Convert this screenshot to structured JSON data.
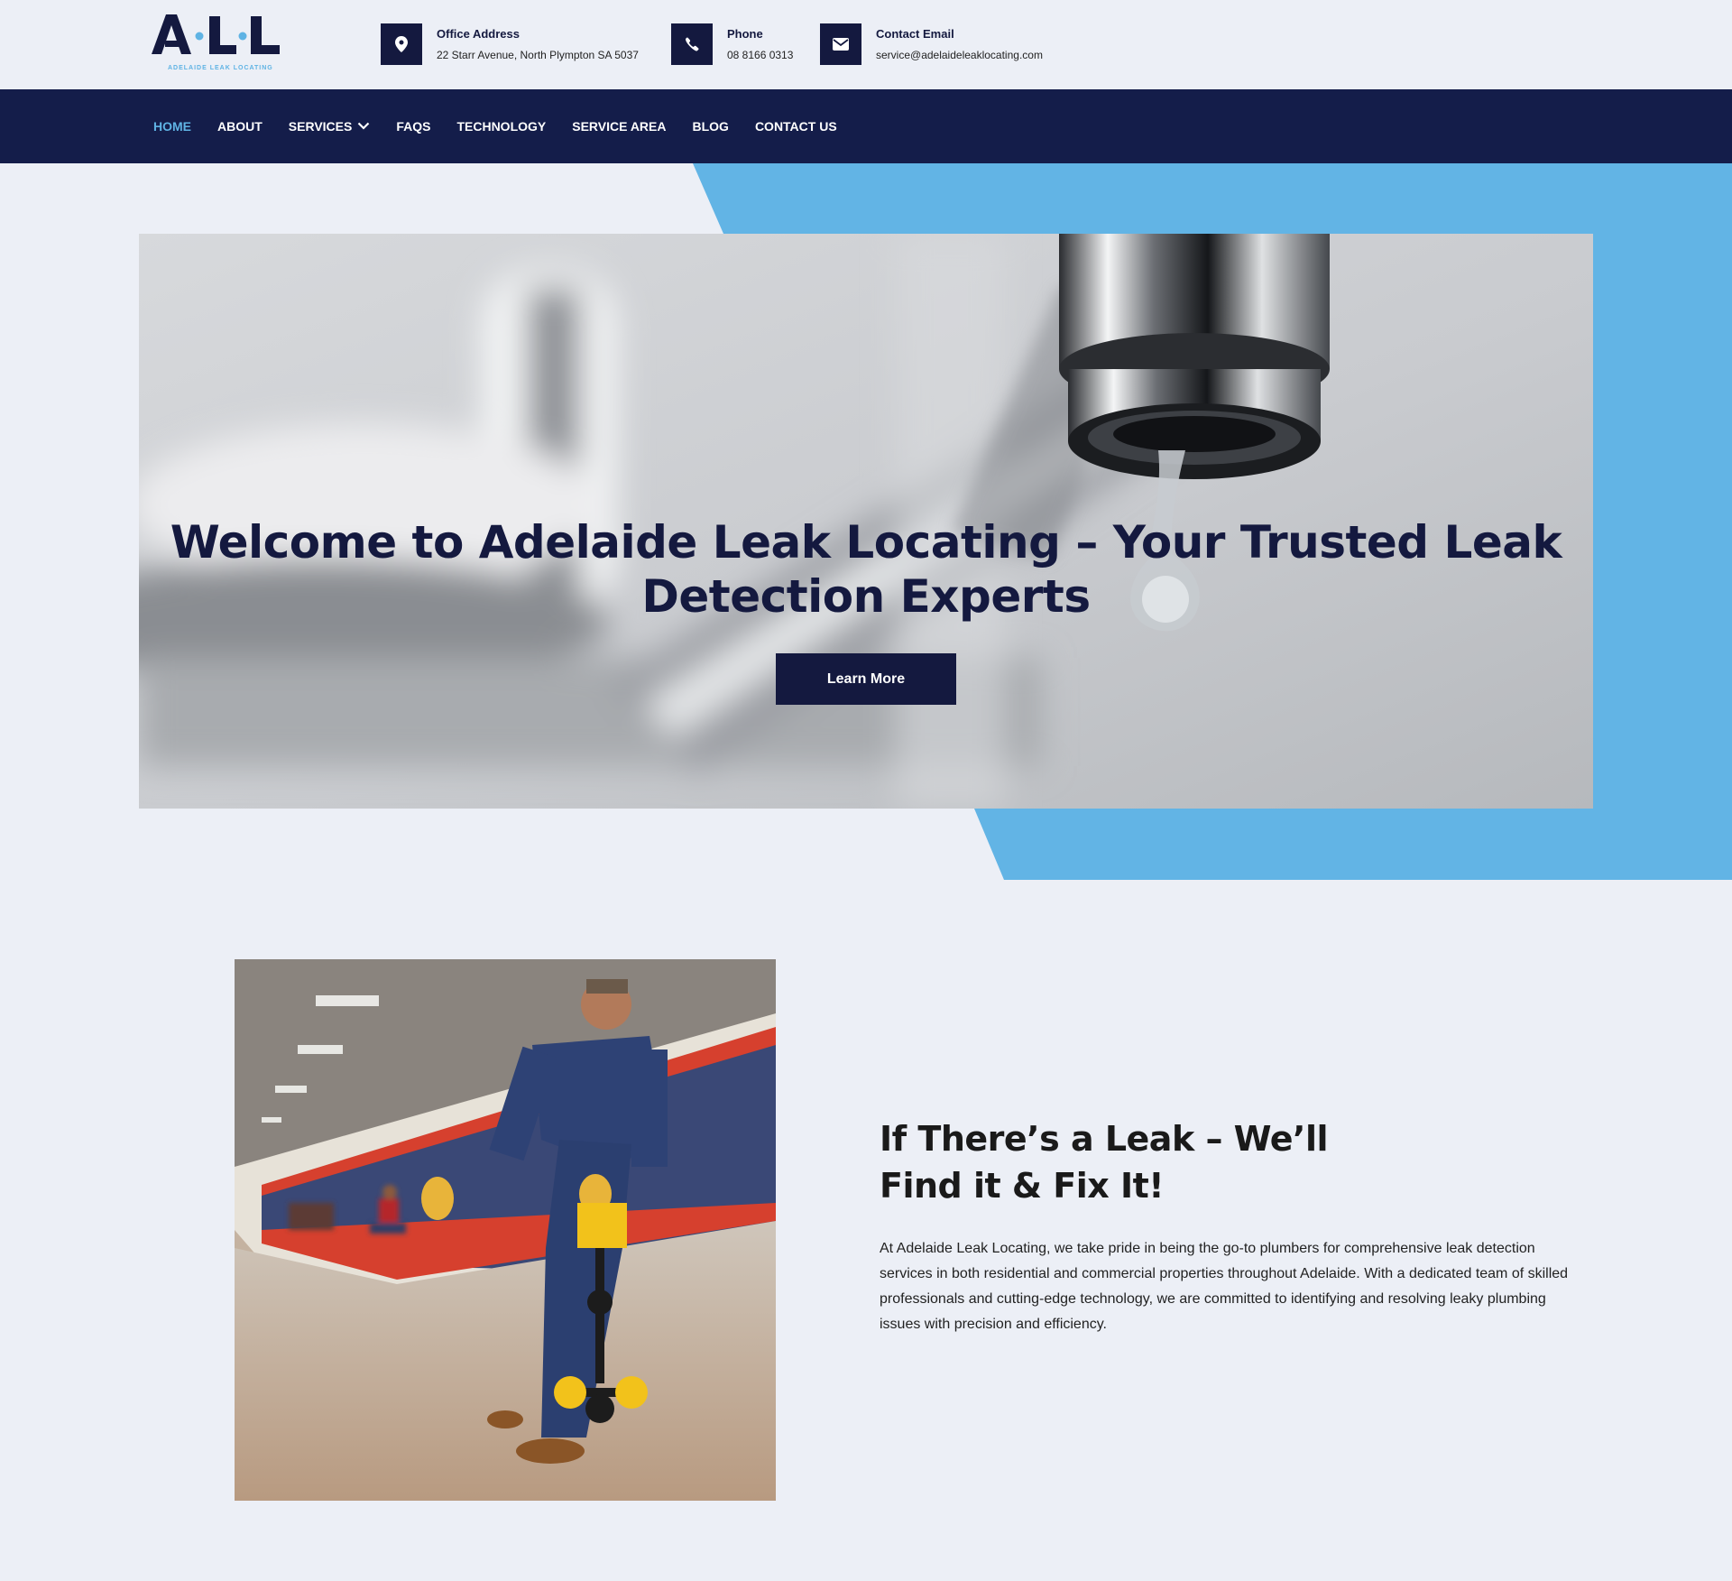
{
  "brand": {
    "logo_text": "A·L·L",
    "logo_tagline": "ADELAIDE LEAK LOCATING"
  },
  "contact": {
    "address_title": "Office Address",
    "address_value": "22 Starr Avenue, North Plympton SA 5037",
    "phone_title": "Phone",
    "phone_value": "08 8166 0313",
    "email_title": "Contact Email",
    "email_value": "service@adelaideleaklocating.com"
  },
  "nav": {
    "home": "Home",
    "about": "About",
    "services": "Services",
    "faqs": "FAQs",
    "technology": "Technology",
    "service_area": "Service Area",
    "blog": "Blog",
    "contact": "Contact Us"
  },
  "hero": {
    "title": "Welcome to Adelaide Leak Locating – Your Trusted Leak Detection Experts",
    "button": "Learn More"
  },
  "about": {
    "title": "If There’s a Leak – We’ll Find it & Fix It!",
    "text": "At Adelaide Leak Locating, we take pride in being the go-to plumbers for comprehensive leak detection services in both residential and commercial properties throughout Adelaide. With a dedicated team of skilled professionals and cutting-edge technology, we are committed to identifying and resolving leaky plumbing issues with precision and efficiency."
  },
  "colors": {
    "navy": "#14193f",
    "accent_blue": "#5fb3e4",
    "page_bg": "#eceff6"
  }
}
